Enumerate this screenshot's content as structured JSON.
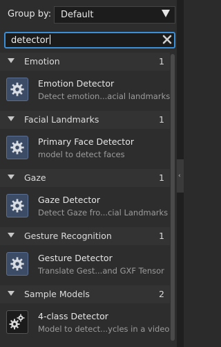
{
  "group_by": {
    "label": "Group by:",
    "value": "Default"
  },
  "search": {
    "value": "detector"
  },
  "groups": [
    {
      "name": "Emotion",
      "count": "1",
      "items": [
        {
          "title": "Emotion Detector",
          "desc": "Detect emotion...acial landmarks",
          "icon": "gear-icon"
        }
      ]
    },
    {
      "name": "Facial Landmarks",
      "count": "1",
      "items": [
        {
          "title": "Primary Face Detector",
          "desc": "model to detect faces",
          "icon": "gear-icon"
        }
      ]
    },
    {
      "name": "Gaze",
      "count": "1",
      "items": [
        {
          "title": "Gaze Detector",
          "desc": "Detect Gaze fro...cial Landmarks",
          "icon": "gear-icon"
        }
      ]
    },
    {
      "name": "Gesture Recognition",
      "count": "1",
      "items": [
        {
          "title": "Gesture Detector",
          "desc": "Translate Gest...and GXF Tensor",
          "icon": "gear-icon"
        }
      ]
    },
    {
      "name": "Sample Models",
      "count": "2",
      "items": [
        {
          "title": "4-class Detector",
          "desc": "Model to detect...ycles in a video",
          "icon": "gears-icon"
        }
      ]
    }
  ],
  "colors": {
    "accent": "#3a8fd8",
    "icon_bg": "#3d4c66"
  }
}
